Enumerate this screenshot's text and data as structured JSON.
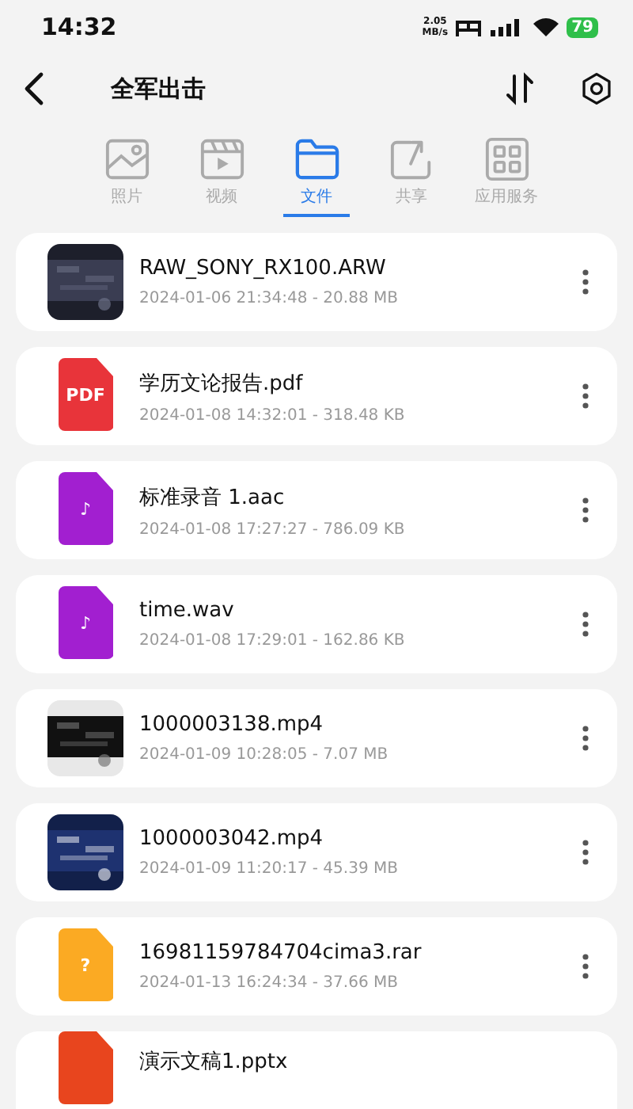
{
  "status_bar": {
    "time": "14:32",
    "speed_value": "2.05",
    "speed_unit": "MB/s",
    "battery": "79"
  },
  "header": {
    "title": "全军出击"
  },
  "tabs": [
    {
      "label": "照片",
      "selected": false
    },
    {
      "label": "视频",
      "kind": "video",
      "selected": false
    },
    {
      "label": "文件",
      "kind": "folder",
      "selected": true
    },
    {
      "label": "共享",
      "kind": "share",
      "selected": false
    },
    {
      "label": "应用服务",
      "kind": "apps",
      "selected": false
    }
  ],
  "files": [
    {
      "name": "RAW_SONY_RX100.ARW",
      "info": "2024-01-06 21:34:48 - 20.88 MB"
    },
    {
      "name": "学历文论报告.pdf",
      "info": "2024-01-08 14:32:01 - 318.48 KB",
      "icon": {
        "kind": "doc",
        "color": "#e8343a",
        "glyph": "PDF"
      }
    },
    {
      "name": "标准录音 1.aac",
      "info": "2024-01-08 17:27:27 - 786.09 KB",
      "icon": {
        "kind": "doc",
        "color": "#a21fd0",
        "glyph": "♪"
      }
    },
    {
      "name": "time.wav",
      "info": "2024-01-08 17:29:01 - 162.86 KB",
      "icon": {
        "kind": "doc",
        "color": "#a21fd0",
        "glyph": "♪"
      }
    },
    {
      "name": "1000003138.mp4",
      "info": "2024-01-09 10:28:05 - 7.07 MB"
    },
    {
      "name": "1000003042.mp4",
      "info": "2024-01-09 11:20:17 - 45.39 MB"
    },
    {
      "name": "16981159784704cima3.rar",
      "info": "2024-01-13 16:24:34 - 37.66 MB",
      "icon": {
        "kind": "doc",
        "color": "#fbaa23",
        "glyph": "?"
      }
    },
    {
      "name": "演示文稿1.pptx",
      "icon": {
        "kind": "doc",
        "color": "#e8451e"
      }
    }
  ]
}
